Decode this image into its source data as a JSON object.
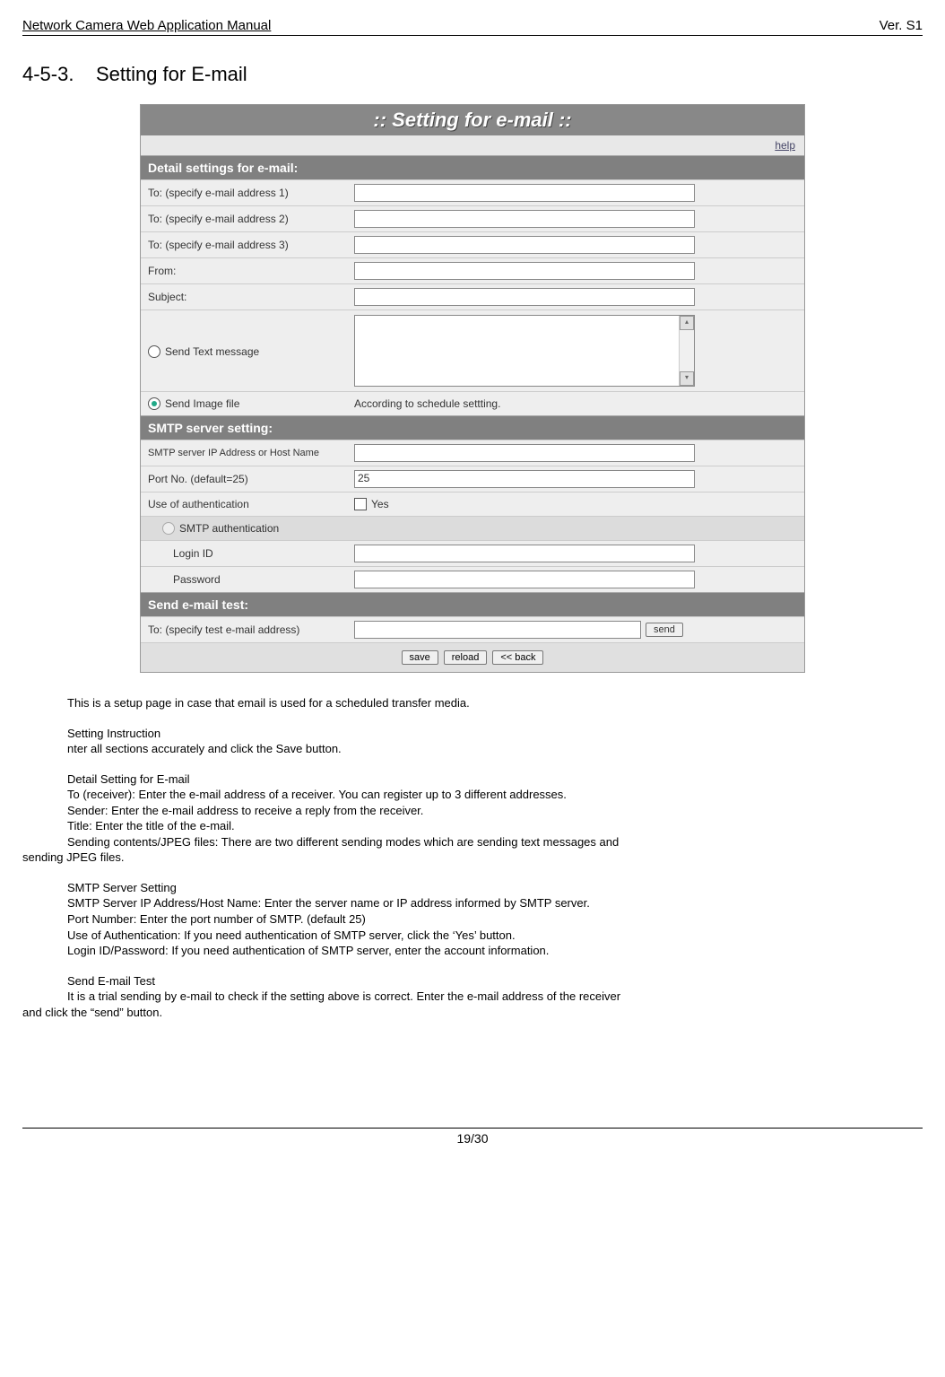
{
  "header": {
    "doc_title": "Network Camera Web Application Manual",
    "version": "Ver. S1"
  },
  "section": {
    "number": "4-5-3.",
    "title": "Setting for E-mail"
  },
  "panel": {
    "title": ":: Setting for e-mail ::",
    "help": "help",
    "detail_header": "Detail settings for e-mail:",
    "smtp_header": "SMTP server setting:",
    "test_header": "Send e-mail test:",
    "rows": {
      "to1": "To: (specify e-mail address 1)",
      "to2": "To: (specify e-mail address 2)",
      "to3": "To: (specify e-mail address 3)",
      "from": "From:",
      "subject": "Subject:",
      "send_text": "Send Text message",
      "send_image": "Send Image file",
      "send_image_note": "According to schedule settting.",
      "smtp_host": "SMTP server IP Address or Host Name",
      "port_label": "Port No. (default=25)",
      "port_value": "25",
      "auth_label": "Use of authentication",
      "auth_yes": "Yes",
      "smtp_auth": "SMTP authentication",
      "login_id": "Login ID",
      "password": "Password",
      "test_to": "To: (specify test e-mail address)",
      "send_btn": "send"
    },
    "buttons": {
      "save": "save",
      "reload": "reload",
      "back": "<< back"
    }
  },
  "body": {
    "intro": "This is a setup page in case that email is used for a scheduled transfer media.",
    "setting_instruction_h": "Setting Instruction",
    "setting_instruction_b": "nter all sections accurately and click the Save button.",
    "detail_h": "Detail Setting for E-mail",
    "detail_to": "To (receiver): Enter the e-mail address of a receiver. You can register up to 3 different addresses.",
    "detail_sender": "Sender: Enter the e-mail address to receive a reply from the receiver.",
    "detail_title": "Title: Enter the title of the e-mail.",
    "detail_sending_1": "Sending contents/JPEG files: There are two different sending modes which are sending text messages and",
    "detail_sending_2": "sending JPEG files.",
    "smtp_h": "SMTP Server Setting",
    "smtp_host": "SMTP Server IP Address/Host Name: Enter the server name or IP address informed by SMTP server.",
    "smtp_port": "Port Number: Enter the port number of SMTP. (default 25)",
    "smtp_auth": "Use of Authentication: If you need authentication of SMTP server, click the ‘Yes’ button.",
    "smtp_login": "Login ID/Password: If you need authentication of SMTP server, enter the account information.",
    "test_h": "Send E-mail Test",
    "test_b1": "It is a trial sending by e-mail to check if the setting above is correct. Enter the e-mail address of the receiver",
    "test_b2": "and click the “send” button."
  },
  "footer": {
    "page": "19/30"
  }
}
